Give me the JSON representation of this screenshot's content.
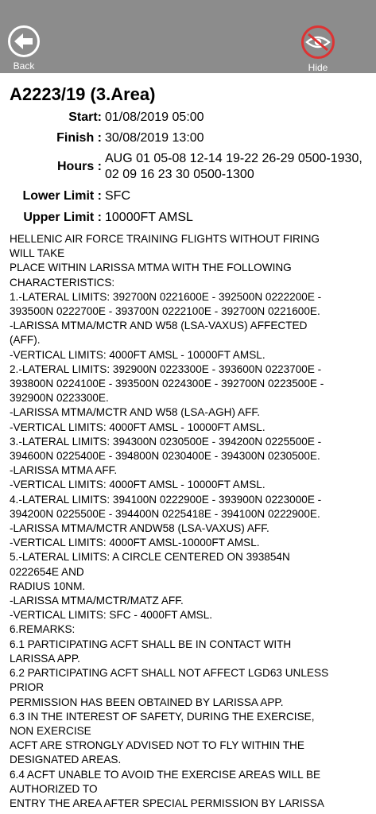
{
  "toolbar": {
    "back_label": "Back",
    "hide_label": "Hide"
  },
  "notam": {
    "title": "A2223/19 (3.Area)",
    "start_label": "Start:",
    "start_value": "01/08/2019 05:00",
    "finish_label": "Finish :",
    "finish_value": "30/08/2019 13:00",
    "hours_label": "Hours :",
    "hours_value": "AUG 01 05-08 12-14 19-22 26-29 0500-1930, 02 09 16 23 30 0500-1300",
    "lower_label": "Lower Limit :",
    "lower_value": "SFC",
    "upper_label": "Upper Limit :",
    "upper_value": "10000FT AMSL",
    "body_lines": [
      "HELLENIC AIR FORCE TRAINING FLIGHTS WITHOUT FIRING",
      "WILL TAKE",
      "PLACE WITHIN LARISSA MTMA WITH THE FOLLOWING",
      "CHARACTERISTICS:",
      "1.-LATERAL LIMITS: 392700N 0221600E - 392500N 0222200E -",
      "393500N 0222700E - 393700N 0222100E - 392700N 0221600E.",
      "-LARISSA MTMA/MCTR AND W58 (LSA-VAXUS) AFFECTED",
      "(AFF).",
      "-VERTICAL LIMITS: 4000FT AMSL - 10000FT AMSL.",
      "2.-LATERAL LIMITS: 392900N 0223300E - 393600N 0223700E -",
      "393800N 0224100E - 393500N 0224300E - 392700N 0223500E -",
      "392900N 0223300E.",
      "-LARISSA MTMA/MCTR AND W58 (LSA-AGH) AFF.",
      "-VERTICAL LIMITS: 4000FT AMSL - 10000FT AMSL.",
      "3.-LATERAL LIMITS: 394300N 0230500E - 394200N 0225500E -",
      "394600N 0225400E - 394800N 0230400E - 394300N 0230500E.",
      "-LARISSA MTMA AFF.",
      "-VERTICAL LIMITS: 4000FT AMSL - 10000FT AMSL.",
      "4.-LATERAL LIMITS: 394100N 0222900E - 393900N 0223000E -",
      "394200N 0225500E - 394400N 0225418E - 394100N 0222900E.",
      "-LARISSA MTMA/MCTR ANDW58 (LSA-VAXUS) AFF.",
      "-VERTICAL LIMITS: 4000FT AMSL-10000FT AMSL.",
      "5.-LATERAL LIMITS: A CIRCLE CENTERED ON 393854N",
      "0222654E AND",
      "RADIUS 10NM.",
      "-LARISSA MTMA/MCTR/MATZ AFF.",
      "-VERTICAL LIMITS: SFC - 4000FT AMSL.",
      "6.REMARKS:",
      "6.1 PARTICIPATING ACFT SHALL BE IN CONTACT WITH",
      "LARISSA APP.",
      "6.2 PARTICIPATING ACFT SHALL NOT AFFECT LGD63 UNLESS",
      "PRIOR",
      "PERMISSION HAS BEEN OBTAINED BY LARISSA APP.",
      "6.3 IN THE INTEREST OF SAFETY, DURING THE EXERCISE,",
      "NON EXERCISE",
      "ACFT ARE STRONGLY ADVISED NOT TO FLY WITHIN THE",
      "DESIGNATED AREAS.",
      "6.4 ACFT UNABLE TO AVOID THE EXERCISE AREAS WILL BE",
      "AUTHORIZED TO",
      "ENTRY THE AREA AFTER SPECIAL PERMISSION BY LARISSA"
    ]
  }
}
